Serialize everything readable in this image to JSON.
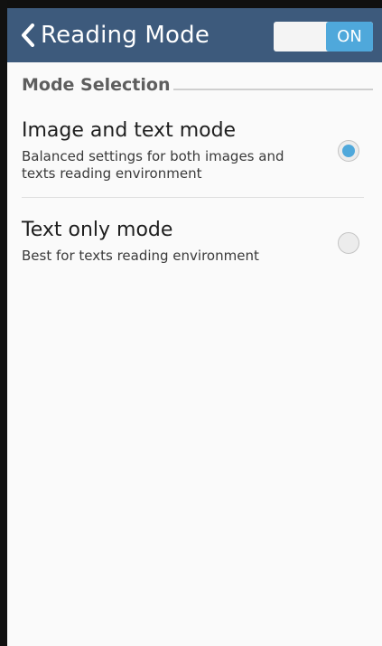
{
  "app_bar": {
    "title": "Reading Mode",
    "back_icon": "chevron-left-icon",
    "toggle": {
      "label": "ON",
      "state": "on"
    }
  },
  "section": {
    "title": "Mode Selection"
  },
  "options": [
    {
      "title": "Image and text mode",
      "description": "Balanced settings for both images and texts reading environment",
      "selected": true
    },
    {
      "title": "Text only mode",
      "description": "Best for texts reading environment",
      "selected": false
    }
  ],
  "colors": {
    "app_bar": "#3d5a7c",
    "accent": "#4fa8db",
    "background": "#fafafa"
  }
}
